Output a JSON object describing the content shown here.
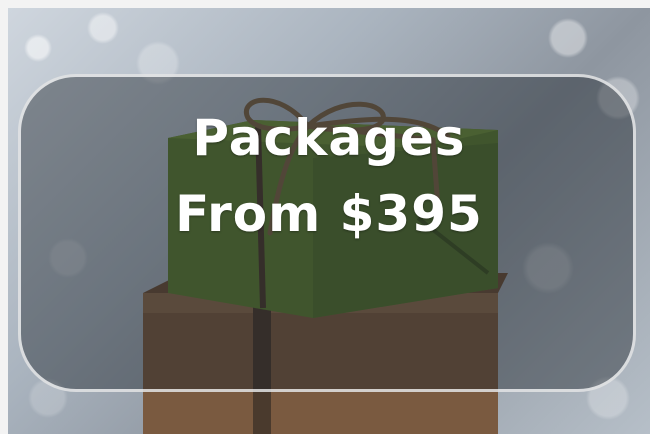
{
  "promo": {
    "line1": "Packages",
    "line2": "From $395"
  },
  "colors": {
    "gift_green": "#5e7d33",
    "gift_brown": "#7a5a40",
    "overlay": "#191e26",
    "text": "#ffffff"
  },
  "icons": {
    "background": "gift-box-photo"
  }
}
